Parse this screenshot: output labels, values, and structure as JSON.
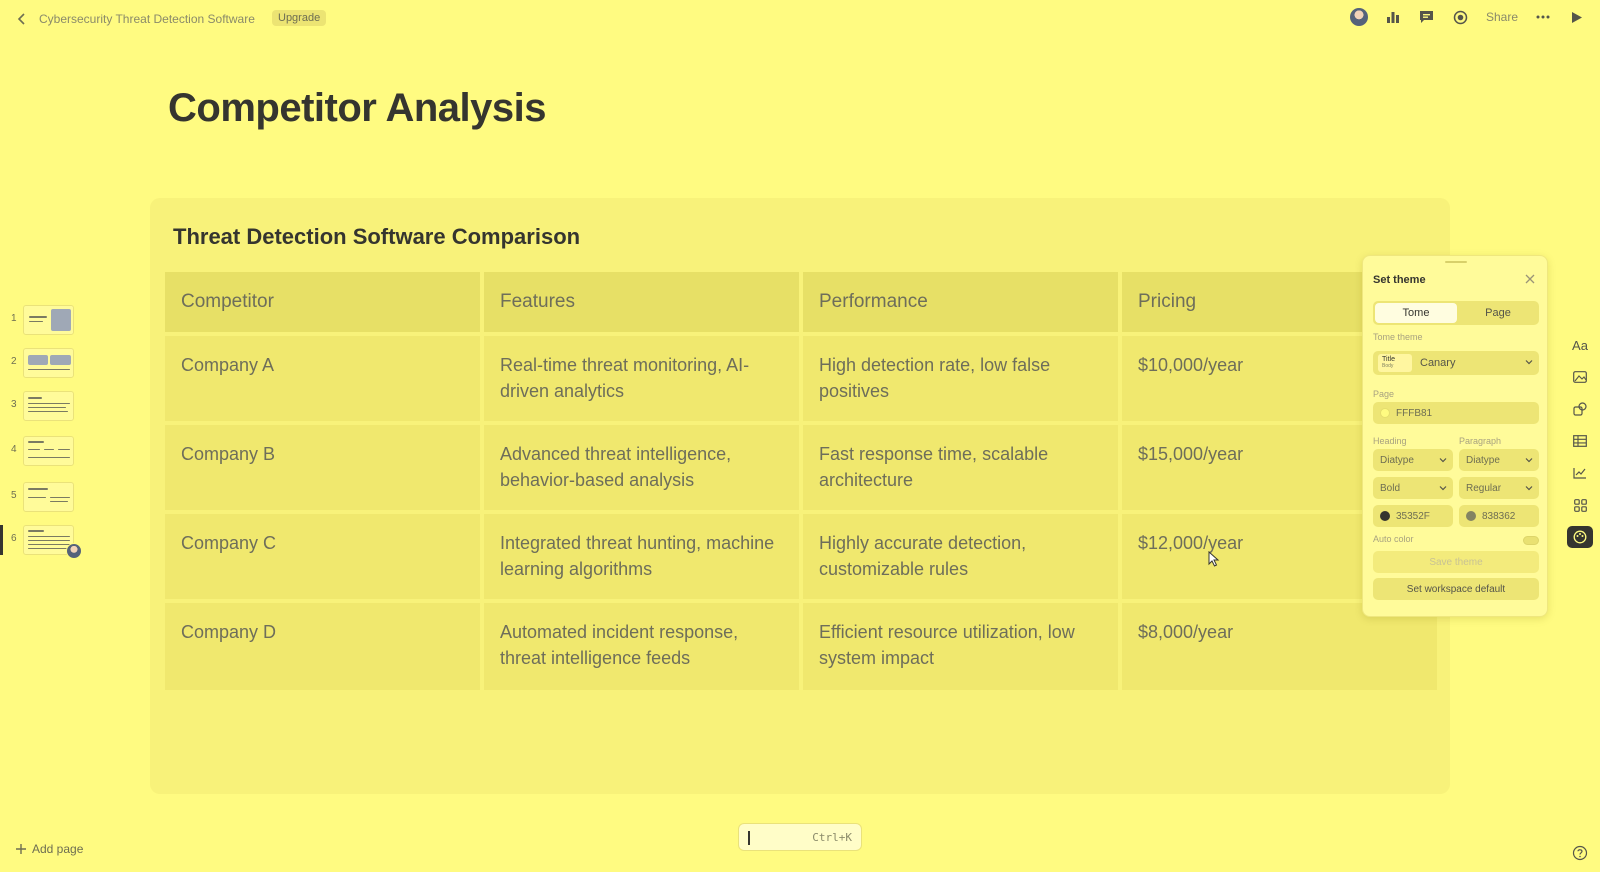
{
  "topbar": {
    "doc_title": "Cybersecurity Threat Detection Software",
    "upgrade_label": "Upgrade",
    "share_label": "Share"
  },
  "page": {
    "title": "Competitor Analysis",
    "background": "#FFFB81"
  },
  "table": {
    "title": "Threat Detection Software Comparison",
    "headers": [
      "Competitor",
      "Features",
      "Performance",
      "Pricing"
    ],
    "rows": [
      [
        "Company A",
        "Real-time threat monitoring, AI-driven analytics",
        "High detection rate, low false positives",
        "$10,000/year"
      ],
      [
        "Company B",
        "Advanced threat intelligence, behavior-based analysis",
        "Fast response time, scalable architecture",
        "$15,000/year"
      ],
      [
        "Company C",
        "Integrated threat hunting, machine learning algorithms",
        "Highly accurate detection, customizable rules",
        "$12,000/year"
      ],
      [
        "Company D",
        "Automated incident response, threat intelligence feeds",
        "Efficient resource utilization, low system impact",
        "$8,000/year"
      ]
    ]
  },
  "slides": {
    "numbers": [
      "1",
      "2",
      "3",
      "4",
      "5",
      "6"
    ],
    "active_index": 6
  },
  "add_page_label": "Add page",
  "command_bar": {
    "shortcut": "Ctrl+K"
  },
  "theme_panel": {
    "title": "Set theme",
    "tabs": [
      "Tome",
      "Page"
    ],
    "tome_theme_label": "Tome theme",
    "theme_name": "Canary",
    "swatch_title": "Title",
    "swatch_body": "Body",
    "page_label": "Page",
    "page_color": "FFFB81",
    "heading_label": "Heading",
    "paragraph_label": "Paragraph",
    "heading_font": "Diatype",
    "paragraph_font": "Diatype",
    "heading_weight": "Bold",
    "paragraph_weight": "Regular",
    "heading_color": "35352F",
    "paragraph_color": "838362",
    "auto_color_label": "Auto color",
    "save_label": "Save theme",
    "workspace_default_label": "Set workspace default"
  },
  "right_toolbar": {
    "text_tool_label": "Aa"
  },
  "colors": {
    "heading": "#35352F",
    "paragraph": "#838362",
    "page": "#FFFB81"
  }
}
